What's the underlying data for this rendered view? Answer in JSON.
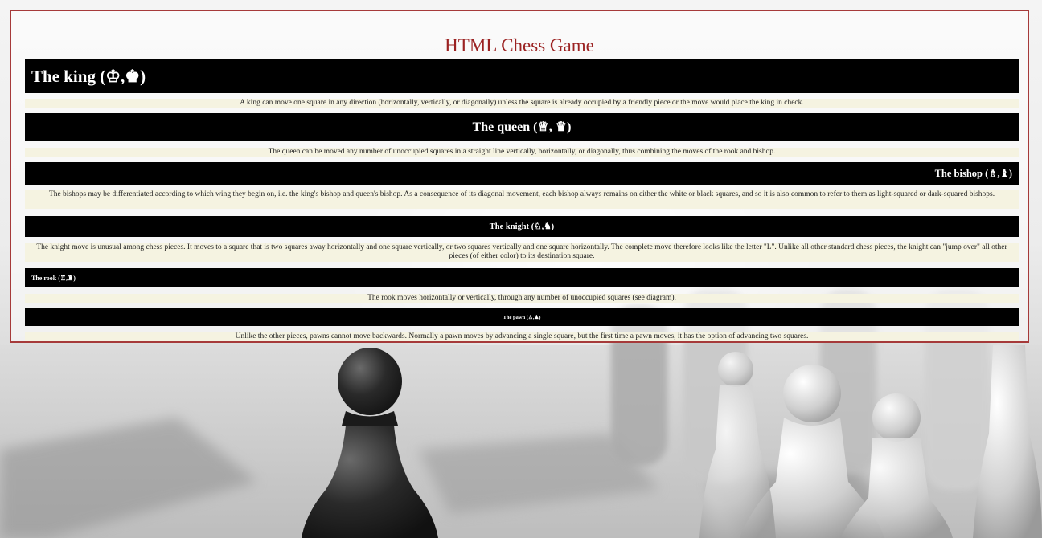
{
  "page": {
    "title": "HTML Chess Game"
  },
  "sections": [
    {
      "heading": "The king (♔,♚)",
      "description": "A king can move one square in any direction (horizontally, vertically, or diagonally) unless the square is already occupied by a friendly piece or the move would place the king in check."
    },
    {
      "heading": "The queen (♕, ♛)",
      "description": "The queen can be moved any number of unoccupied squares in a straight line vertically, horizontally, or diagonally, thus combining the moves of the rook and bishop."
    },
    {
      "heading": "The bishop (♗,♝)",
      "description": "The bishops may be differentiated according to which wing they begin on, i.e. the king's bishop and queen's bishop. As a consequence of its diagonal movement, each bishop always remains on either the white or black squares, and so it is also common to refer to them as light-squared or dark-squared bishops."
    },
    {
      "heading": "The knight (♘,♞)",
      "description": "The knight move is unusual among chess pieces. It moves to a square that is two squares away horizontally and one square vertically, or two squares vertically and one square horizontally. The complete move therefore looks like the letter \"L\". Unlike all other standard chess pieces, the knight can \"jump over\" all other pieces (of either color) to its destination square."
    },
    {
      "heading": "The rook (♖,♜)",
      "description": "The rook moves horizontally or vertically, through any number of unoccupied squares (see diagram)."
    },
    {
      "heading": "The pawn (♙,♟)",
      "description": "Unlike the other pieces, pawns cannot move backwards. Normally a pawn moves by advancing a single square, but the first time a pawn moves, it has the option of advancing two squares."
    }
  ],
  "colors": {
    "title": "#9b2222",
    "panel_border": "#a63a3a",
    "header_bg": "#000000",
    "header_text": "#ffffff",
    "desc_bg": "#f5f3e1"
  },
  "icons": {
    "background": "chess-pieces-photo"
  }
}
